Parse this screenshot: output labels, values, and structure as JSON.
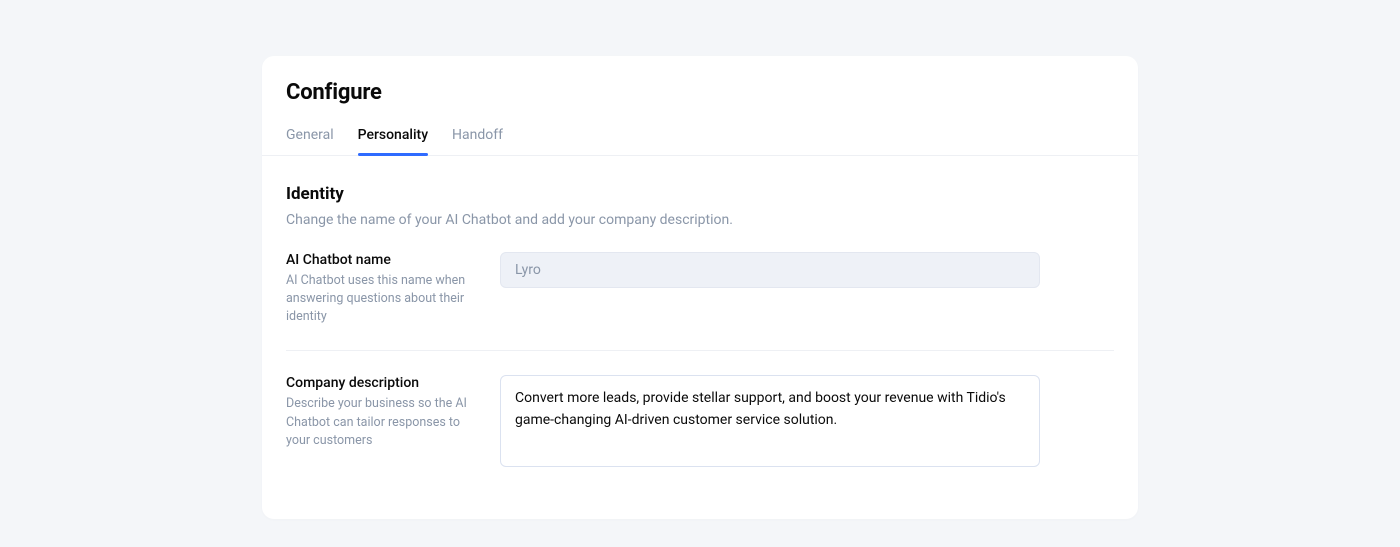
{
  "header": {
    "title": "Configure"
  },
  "tabs": [
    {
      "label": "General",
      "active": false
    },
    {
      "label": "Personality",
      "active": true
    },
    {
      "label": "Handoff",
      "active": false
    }
  ],
  "identity": {
    "title": "Identity",
    "description": "Change the name of your AI Chatbot and add your company description.",
    "name_field": {
      "label": "AI Chatbot name",
      "help": "AI Chatbot uses this name when answering questions about their identity",
      "value": "Lyro"
    },
    "company_field": {
      "label": "Company description",
      "help": "Describe your business so the AI Chatbot can tailor responses to your customers",
      "value": "Convert more leads, provide stellar support, and boost your revenue with Tidio's game-changing AI-driven customer service solution."
    }
  }
}
